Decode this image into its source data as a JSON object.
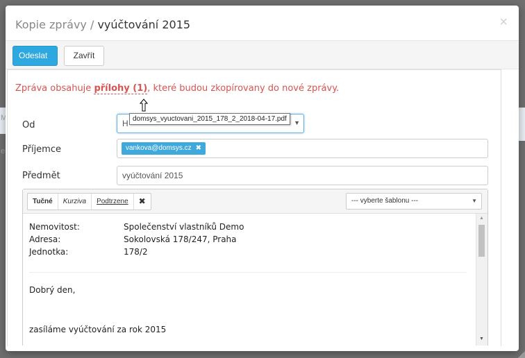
{
  "modal": {
    "title_prefix": "Kopie zprávy / ",
    "title_doc": "vyúčtování 2015",
    "close_glyph": "×"
  },
  "toolbar": {
    "send_label": "Odeslat",
    "close_label": "Zavřít"
  },
  "warning": {
    "before": "Zpráva obsahuje ",
    "link": "přílohy (1)",
    "after": ", které budou zkopírovany do nové zprávy."
  },
  "tooltip": {
    "text": "domsys_vyuctovani_2015_178_2_2018-04-17.pdf"
  },
  "form": {
    "from_label": "Od",
    "from_value": "H",
    "recipient_label": "Příjemce",
    "recipient_tag": "vankova@domsys.cz",
    "subject_label": "Předmět",
    "subject_value": "vyúčtování 2015"
  },
  "editor": {
    "bold": "Tučné",
    "italic": "Kurziva",
    "underline": "Podtrzene",
    "clear": "✖",
    "template_placeholder": "--- vyberte šablonu ---",
    "rows": [
      {
        "k": "Nemovitost:",
        "v": "Společenství vlastníků Demo"
      },
      {
        "k": "Adresa:",
        "v": "Sokolovská 178/247, Praha"
      },
      {
        "k": "Jednotka:",
        "v": "178/2"
      }
    ],
    "greeting": "Dobrý den,",
    "line": "zasíláme vyúčtování za rok 2015"
  },
  "background": {
    "letters": [
      "M",
      "e"
    ]
  }
}
